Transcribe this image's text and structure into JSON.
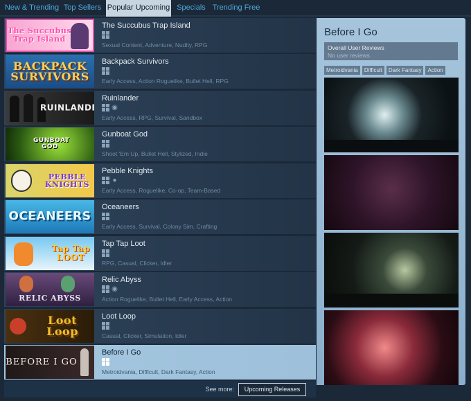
{
  "tabs": [
    {
      "label": "New & Trending"
    },
    {
      "label": "Top Sellers"
    },
    {
      "label": "Popular Upcoming"
    },
    {
      "label": "Specials"
    },
    {
      "label": "Trending Free"
    }
  ],
  "games": [
    {
      "title": "The Succubus Trap Island",
      "platforms": [
        "windows"
      ],
      "tags": "Sexual Content, Adventure, Nudity, RPG",
      "thumb_text": "The Succubus Trap Island"
    },
    {
      "title": "Backpack Survivors",
      "platforms": [
        "windows"
      ],
      "tags": "Early Access, Action Roguelike, Bullet Hell, RPG",
      "thumb_text": "BACKPACK SURVIVORS"
    },
    {
      "title": "Ruinlander",
      "platforms": [
        "windows",
        "steam"
      ],
      "tags": "Early Access, RPG, Survival, Sandbox",
      "thumb_text": "RUINLANDER"
    },
    {
      "title": "Gunboat God",
      "platforms": [
        "windows"
      ],
      "tags": "Shoot 'Em Up, Bullet Hell, Stylized, Indie",
      "thumb_text": "GUNBOAT GOD"
    },
    {
      "title": "Pebble Knights",
      "platforms": [
        "windows",
        "apple"
      ],
      "tags": "Early Access, Roguelike, Co-op, Team-Based",
      "thumb_text": "PEBBLE KNIGHTS"
    },
    {
      "title": "Oceaneers",
      "platforms": [
        "windows"
      ],
      "tags": "Early Access, Survival, Colony Sim, Crafting",
      "thumb_text": "OCEANEERS"
    },
    {
      "title": "Tap Tap Loot",
      "platforms": [
        "windows"
      ],
      "tags": "RPG, Casual, Clicker, Idler",
      "thumb_text": "Tap Tap LOOT"
    },
    {
      "title": "Relic Abyss",
      "platforms": [
        "windows",
        "steam"
      ],
      "tags": "Action Roguelike, Bullet Hell, Early Access, Action",
      "thumb_text": "RELIC ABYSS"
    },
    {
      "title": "Loot Loop",
      "platforms": [
        "windows"
      ],
      "tags": "Casual, Clicker, Simulation, Idler",
      "thumb_text": "Loot Loop"
    },
    {
      "title": "Before I Go",
      "platforms": [
        "windows"
      ],
      "tags": "Metroidvania, Difficult, Dark Fantasy, Action",
      "thumb_text": "BEFORE I GO"
    }
  ],
  "footer": {
    "see_more": "See more:",
    "button": "Upcoming Releases"
  },
  "preview": {
    "title": "Before I Go",
    "review_label": "Overall User Reviews",
    "review_value": "No user reviews",
    "tags": [
      "Metroidvania",
      "Difficult",
      "Dark Fantasy",
      "Action"
    ]
  },
  "colors": {
    "background": "#1b2838",
    "link": "#4fa9d8",
    "selected_row": "#a4c7e0",
    "preview_panel": "#a6c5dd"
  }
}
